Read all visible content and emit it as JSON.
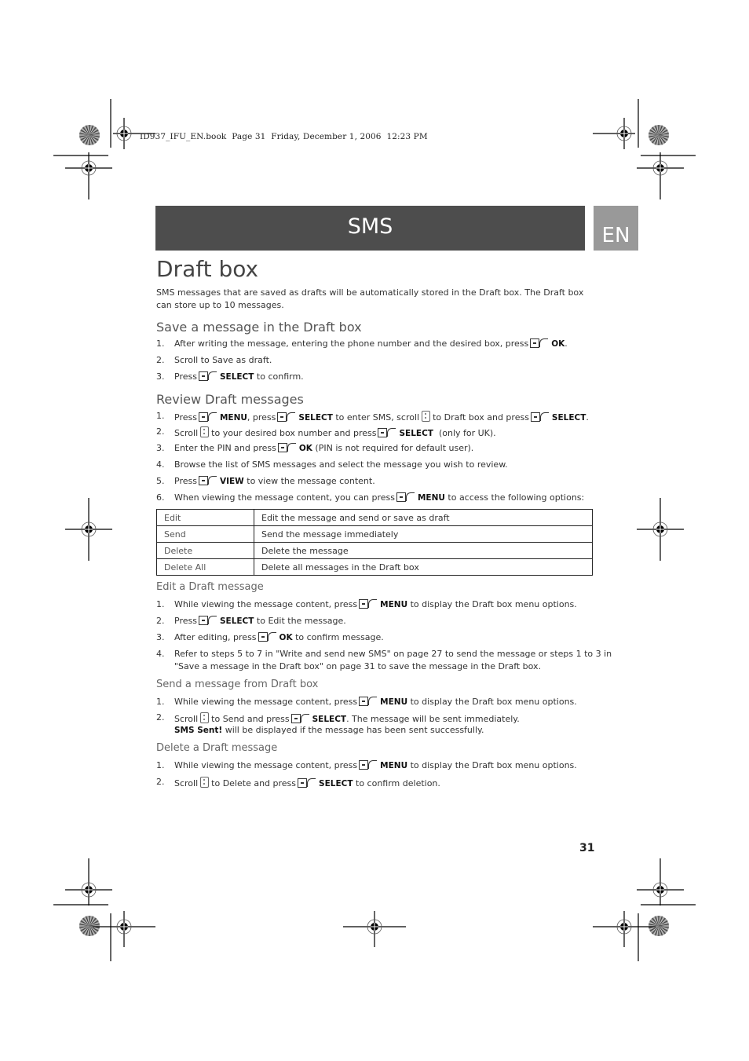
{
  "slug_line": "ID937_IFU_EN.book  Page 31  Friday, December 1, 2006  12:23 PM",
  "banner": {
    "title": "SMS",
    "lang": "EN"
  },
  "page_title": "Draft box",
  "intro": "SMS messages that are saved as drafts will be automatically stored in the Draft box. The Draft box can store up to 10 messages.",
  "sections": {
    "save": {
      "heading": "Save a message in the Draft box",
      "steps": [
        {
          "n": "1.",
          "pre": "After writing the message, entering the phone number and the desired box, press",
          "key": "OK",
          "post": "."
        },
        {
          "n": "2.",
          "pre": "Scroll to Save as draft."
        },
        {
          "n": "3.",
          "pre": "Press",
          "key": "SELECT",
          "post": "to confirm."
        }
      ]
    },
    "review": {
      "heading": "Review Draft messages",
      "steps": [
        {
          "n": "1.",
          "a": "Press",
          "k1": "MENU",
          "b": ", press",
          "k2": "SELECT",
          "c": "to enter SMS, scroll",
          "d": "to Draft box and press",
          "k3": "SELECT",
          "e": "."
        },
        {
          "n": "2.",
          "a": "Scroll",
          "b": "to your desired box number and press",
          "k1": "SELECT",
          "c": "(only for UK)."
        },
        {
          "n": "3.",
          "a": "Enter the PIN and press",
          "k1": "OK",
          "b": "(PIN is not required for default user)."
        },
        {
          "n": "4.",
          "a": "Browse the list of SMS messages and select the message you wish to review."
        },
        {
          "n": "5.",
          "a": "Press",
          "k1": "VIEW",
          "b": "to view the message content."
        },
        {
          "n": "6.",
          "a": "When viewing the message content, you can press",
          "k1": "MENU",
          "b": "to access the following options:"
        }
      ]
    },
    "options_table": [
      {
        "option": "Edit",
        "description": "Edit the message and send or save as draft"
      },
      {
        "option": "Send",
        "description": "Send the message immediately"
      },
      {
        "option": "Delete",
        "description": "Delete the message"
      },
      {
        "option": "Delete All",
        "description": "Delete all messages in the Draft box"
      }
    ],
    "edit": {
      "heading": "Edit a Draft message",
      "steps": [
        {
          "n": "1.",
          "a": "While viewing the message content, press",
          "k1": "MENU",
          "b": "to display the Draft box menu options."
        },
        {
          "n": "2.",
          "a": "Press",
          "k1": "SELECT",
          "b": "to Edit the message."
        },
        {
          "n": "3.",
          "a": "After editing, press",
          "k1": "OK",
          "b": "to confirm message."
        },
        {
          "n": "4.",
          "a": "Refer to steps 5 to 7 in \"Write and send new SMS\" on page 27 to send the message or steps 1 to 3 in",
          "a2": "\"Save a message in the Draft box\" on page 31 to save the message in the Draft box."
        }
      ]
    },
    "send": {
      "heading": "Send a message from Draft box",
      "steps": [
        {
          "n": "1.",
          "a": "While viewing the message content, press",
          "k1": "MENU",
          "b": "to display the Draft box menu options."
        },
        {
          "n": "2.",
          "a": "Scroll",
          "b": "to Send and press",
          "k1": "SELECT",
          "c": ". The message will be sent immediately.",
          "k2": "SMS Sent!",
          "d": "will be displayed if the message has been sent successfully."
        }
      ]
    },
    "delete": {
      "heading": "Delete a Draft message",
      "steps": [
        {
          "n": "1.",
          "a": "While viewing the message content, press",
          "k1": "MENU",
          "b": "to display the Draft box menu options."
        },
        {
          "n": "2.",
          "a": "Scroll",
          "b": "to Delete and press",
          "k1": "SELECT",
          "c": "to confirm deletion."
        }
      ]
    }
  },
  "page_number": "31"
}
